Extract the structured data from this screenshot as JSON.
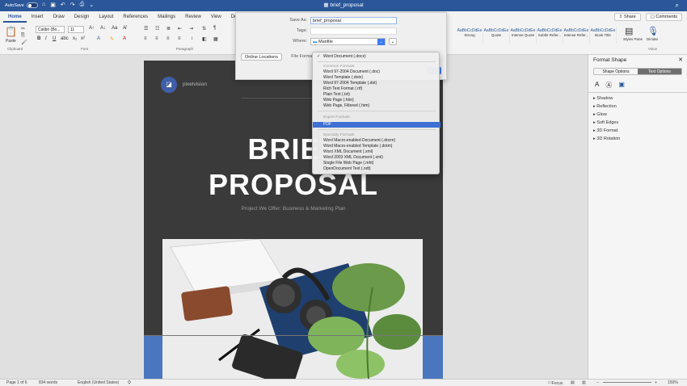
{
  "titlebar": {
    "autosave_label": "AutoSave",
    "autosave_state": "OFF",
    "document_title": "brief_proposal",
    "icons": [
      "home-icon",
      "save-icon",
      "undo-icon",
      "redo-icon",
      "print-icon",
      "more-icon"
    ]
  },
  "tabs": [
    "Home",
    "Insert",
    "Draw",
    "Design",
    "Layout",
    "References",
    "Mailings",
    "Review",
    "View",
    "Developer"
  ],
  "active_tab": "Home",
  "tab_actions": {
    "share": "Share",
    "comments": "Comments"
  },
  "ribbon": {
    "paste_label": "Paste",
    "font_name": "Calibri (Bo...",
    "font_size": "11",
    "group_labels": {
      "clipboard": "Clipboard",
      "font": "Font",
      "paragraph": "Paragraph",
      "styles_pane": "Styles Pane",
      "voice": "Voice",
      "dictate": "Dictate"
    },
    "styles": [
      {
        "sample": "AaBbCcDdEe",
        "name": "Strong"
      },
      {
        "sample": "AaBbCcDdEe",
        "name": "Quote"
      },
      {
        "sample": "AaBbCcDdEe",
        "name": "Intense Quote"
      },
      {
        "sample": "AaBbCcDdEe",
        "name": "Subtle Refer..."
      },
      {
        "sample": "AaBbCcDdEe",
        "name": "Intense Refer..."
      },
      {
        "sample": "AaBbCcDdEe",
        "name": "Book Title"
      }
    ]
  },
  "save_dialog": {
    "save_as_label": "Save As:",
    "save_as_value": "brief_proposal",
    "tags_label": "Tags:",
    "where_label": "Where:",
    "where_value": "Manfile",
    "online_locations": "Online Locations",
    "file_format_label": "File Format"
  },
  "format_menu": {
    "selected_check": "Word Document (.docx)",
    "common_header": "Common Formats",
    "common": [
      "Word 97-2004 Document (.doc)",
      "Word Template (.dotx)",
      "Word 97-2004 Template (.dot)",
      "Rich Text Format (.rtf)",
      "Plain Text (.txt)",
      "Web Page (.htm)",
      "Web Page, Filtered (.htm)"
    ],
    "export_header": "Export Formats",
    "export": [
      "PDF"
    ],
    "specialty_header": "Specialty Formats",
    "specialty": [
      "Word Macro-enabled Document (.docm)",
      "Word Macro-enabled Template (.dotm)",
      "Word XML Document (.xml)",
      "Word 2003 XML Document (.xml)",
      "Single File Web Page (.mht)",
      "OpenDocument Text (.odt)"
    ],
    "highlighted": "PDF"
  },
  "document": {
    "brand": "pixelvision",
    "title_line1": "BRIEF",
    "title_line2": "PROPOSAL",
    "subtitle": "Project We Offer: Business & Marketing Plan"
  },
  "format_panel": {
    "title": "Format Shape",
    "tabs": [
      "Shape Options",
      "Text Options"
    ],
    "active_tab": "Text Options",
    "sections": [
      "Shadow",
      "Reflection",
      "Glow",
      "Soft Edges",
      "3D Format",
      "3D Rotation"
    ]
  },
  "statusbar": {
    "page": "Page 1 of 6",
    "words": "834 words",
    "language": "English (United States)",
    "focus": "Focus",
    "zoom": "150%"
  },
  "colors": {
    "accent": "#2b579a",
    "highlight": "#3d6fd4",
    "page_dark": "#3a3a3a",
    "blue_band": "#4a76c0"
  }
}
